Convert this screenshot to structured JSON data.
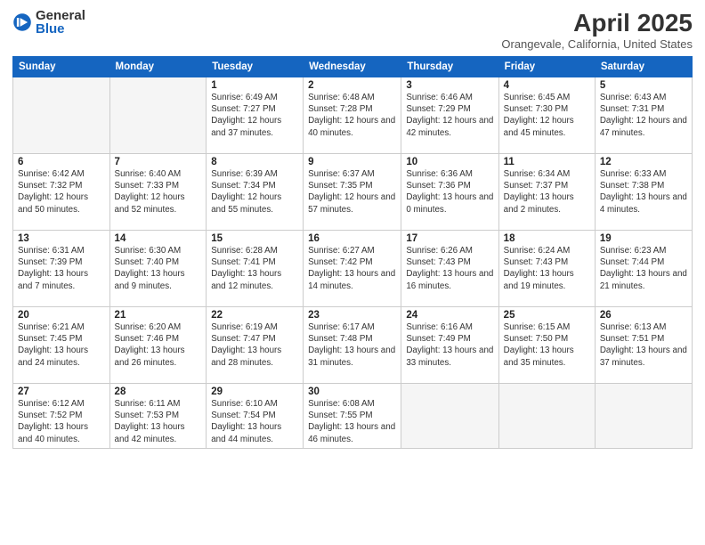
{
  "logo": {
    "general": "General",
    "blue": "Blue"
  },
  "title": "April 2025",
  "subtitle": "Orangevale, California, United States",
  "days_of_week": [
    "Sunday",
    "Monday",
    "Tuesday",
    "Wednesday",
    "Thursday",
    "Friday",
    "Saturday"
  ],
  "weeks": [
    [
      {
        "num": "",
        "info": "",
        "empty": true
      },
      {
        "num": "",
        "info": "",
        "empty": true
      },
      {
        "num": "1",
        "info": "Sunrise: 6:49 AM\nSunset: 7:27 PM\nDaylight: 12 hours and 37 minutes."
      },
      {
        "num": "2",
        "info": "Sunrise: 6:48 AM\nSunset: 7:28 PM\nDaylight: 12 hours and 40 minutes."
      },
      {
        "num": "3",
        "info": "Sunrise: 6:46 AM\nSunset: 7:29 PM\nDaylight: 12 hours and 42 minutes."
      },
      {
        "num": "4",
        "info": "Sunrise: 6:45 AM\nSunset: 7:30 PM\nDaylight: 12 hours and 45 minutes."
      },
      {
        "num": "5",
        "info": "Sunrise: 6:43 AM\nSunset: 7:31 PM\nDaylight: 12 hours and 47 minutes."
      }
    ],
    [
      {
        "num": "6",
        "info": "Sunrise: 6:42 AM\nSunset: 7:32 PM\nDaylight: 12 hours and 50 minutes."
      },
      {
        "num": "7",
        "info": "Sunrise: 6:40 AM\nSunset: 7:33 PM\nDaylight: 12 hours and 52 minutes."
      },
      {
        "num": "8",
        "info": "Sunrise: 6:39 AM\nSunset: 7:34 PM\nDaylight: 12 hours and 55 minutes."
      },
      {
        "num": "9",
        "info": "Sunrise: 6:37 AM\nSunset: 7:35 PM\nDaylight: 12 hours and 57 minutes."
      },
      {
        "num": "10",
        "info": "Sunrise: 6:36 AM\nSunset: 7:36 PM\nDaylight: 13 hours and 0 minutes."
      },
      {
        "num": "11",
        "info": "Sunrise: 6:34 AM\nSunset: 7:37 PM\nDaylight: 13 hours and 2 minutes."
      },
      {
        "num": "12",
        "info": "Sunrise: 6:33 AM\nSunset: 7:38 PM\nDaylight: 13 hours and 4 minutes."
      }
    ],
    [
      {
        "num": "13",
        "info": "Sunrise: 6:31 AM\nSunset: 7:39 PM\nDaylight: 13 hours and 7 minutes."
      },
      {
        "num": "14",
        "info": "Sunrise: 6:30 AM\nSunset: 7:40 PM\nDaylight: 13 hours and 9 minutes."
      },
      {
        "num": "15",
        "info": "Sunrise: 6:28 AM\nSunset: 7:41 PM\nDaylight: 13 hours and 12 minutes."
      },
      {
        "num": "16",
        "info": "Sunrise: 6:27 AM\nSunset: 7:42 PM\nDaylight: 13 hours and 14 minutes."
      },
      {
        "num": "17",
        "info": "Sunrise: 6:26 AM\nSunset: 7:43 PM\nDaylight: 13 hours and 16 minutes."
      },
      {
        "num": "18",
        "info": "Sunrise: 6:24 AM\nSunset: 7:43 PM\nDaylight: 13 hours and 19 minutes."
      },
      {
        "num": "19",
        "info": "Sunrise: 6:23 AM\nSunset: 7:44 PM\nDaylight: 13 hours and 21 minutes."
      }
    ],
    [
      {
        "num": "20",
        "info": "Sunrise: 6:21 AM\nSunset: 7:45 PM\nDaylight: 13 hours and 24 minutes."
      },
      {
        "num": "21",
        "info": "Sunrise: 6:20 AM\nSunset: 7:46 PM\nDaylight: 13 hours and 26 minutes."
      },
      {
        "num": "22",
        "info": "Sunrise: 6:19 AM\nSunset: 7:47 PM\nDaylight: 13 hours and 28 minutes."
      },
      {
        "num": "23",
        "info": "Sunrise: 6:17 AM\nSunset: 7:48 PM\nDaylight: 13 hours and 31 minutes."
      },
      {
        "num": "24",
        "info": "Sunrise: 6:16 AM\nSunset: 7:49 PM\nDaylight: 13 hours and 33 minutes."
      },
      {
        "num": "25",
        "info": "Sunrise: 6:15 AM\nSunset: 7:50 PM\nDaylight: 13 hours and 35 minutes."
      },
      {
        "num": "26",
        "info": "Sunrise: 6:13 AM\nSunset: 7:51 PM\nDaylight: 13 hours and 37 minutes."
      }
    ],
    [
      {
        "num": "27",
        "info": "Sunrise: 6:12 AM\nSunset: 7:52 PM\nDaylight: 13 hours and 40 minutes."
      },
      {
        "num": "28",
        "info": "Sunrise: 6:11 AM\nSunset: 7:53 PM\nDaylight: 13 hours and 42 minutes."
      },
      {
        "num": "29",
        "info": "Sunrise: 6:10 AM\nSunset: 7:54 PM\nDaylight: 13 hours and 44 minutes."
      },
      {
        "num": "30",
        "info": "Sunrise: 6:08 AM\nSunset: 7:55 PM\nDaylight: 13 hours and 46 minutes."
      },
      {
        "num": "",
        "info": "",
        "empty": true
      },
      {
        "num": "",
        "info": "",
        "empty": true
      },
      {
        "num": "",
        "info": "",
        "empty": true
      }
    ]
  ]
}
